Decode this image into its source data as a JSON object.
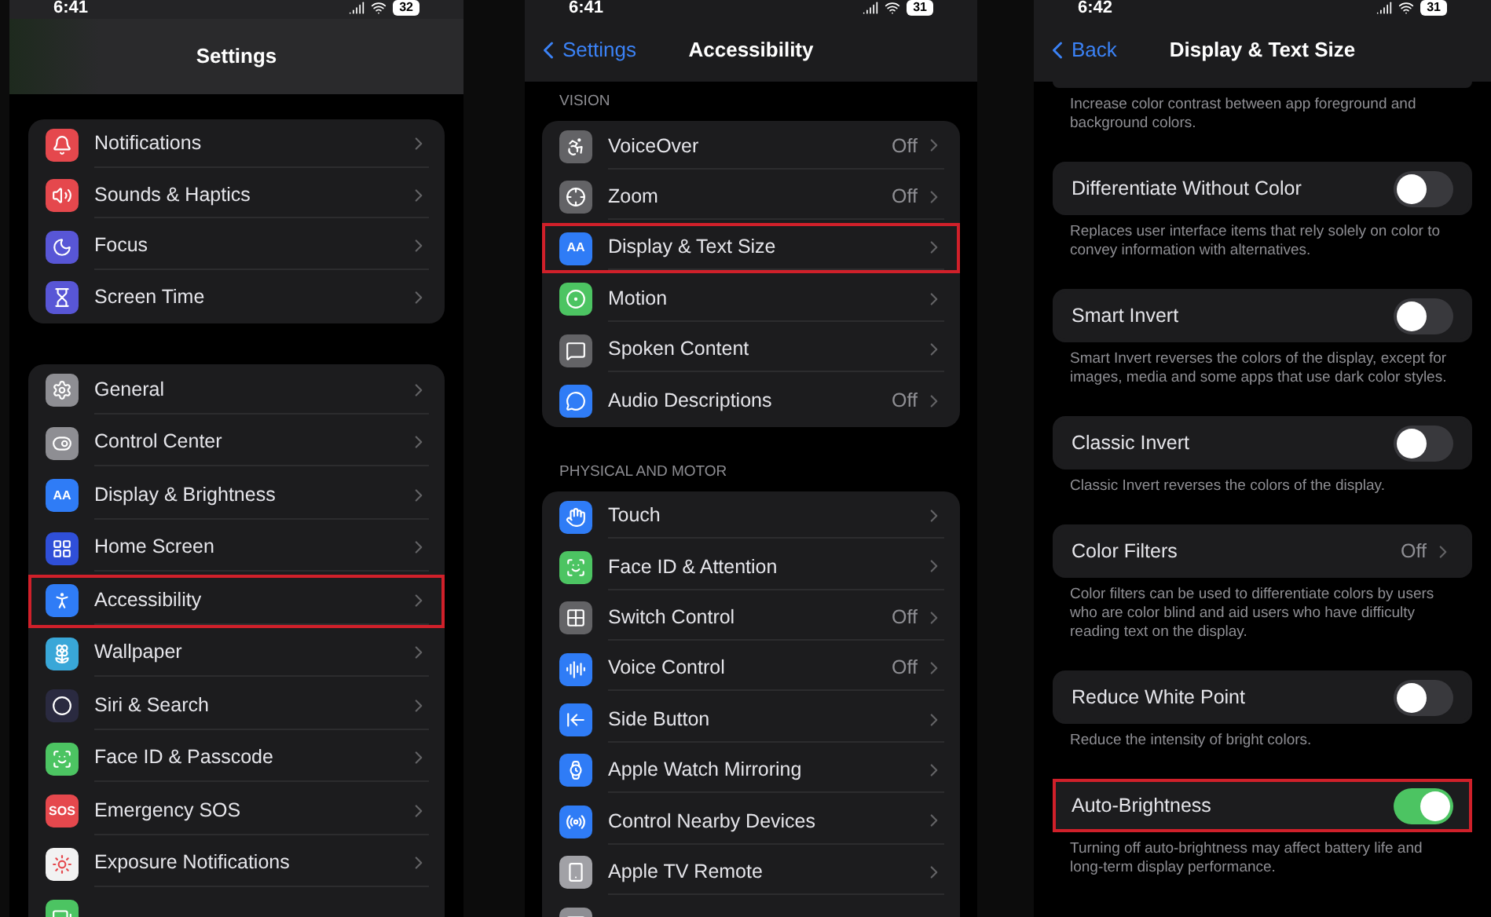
{
  "panels": [
    {
      "status": {
        "time": "6:41",
        "battery": "32"
      },
      "nav": {
        "title": "Settings"
      },
      "sections": [
        {
          "rows": [
            {
              "label": "Notifications",
              "color": "#e5484d",
              "highlighted": false
            },
            {
              "label": "Sounds & Haptics",
              "color": "#e5484d",
              "highlighted": false
            },
            {
              "label": "Focus",
              "color": "#5856d6",
              "highlighted": false
            },
            {
              "label": "Screen Time",
              "color": "#5856d6",
              "highlighted": false
            }
          ]
        },
        {
          "rows": [
            {
              "label": "General",
              "color": "#8e8e93",
              "highlighted": false
            },
            {
              "label": "Control Center",
              "color": "#8e8e93",
              "highlighted": false
            },
            {
              "label": "Display & Brightness",
              "color": "#2f7cf6",
              "badge": "AA",
              "highlighted": false
            },
            {
              "label": "Home Screen",
              "color": "#2f4fd8",
              "highlighted": false
            },
            {
              "label": "Accessibility",
              "color": "#2f7cf6",
              "highlighted": true
            },
            {
              "label": "Wallpaper",
              "color": "#39a7d8",
              "highlighted": false
            },
            {
              "label": "Siri & Search",
              "color": "#2a2a40",
              "highlighted": false
            },
            {
              "label": "Face ID & Passcode",
              "color": "#4cc462",
              "highlighted": false
            },
            {
              "label": "Emergency SOS",
              "color": "#e5484d",
              "badge": "SOS",
              "highlighted": false
            },
            {
              "label": "Exposure Notifications",
              "color": "#f2f2f2",
              "highlighted": false
            },
            {
              "color": "#4cc462",
              "highlighted": false
            }
          ]
        }
      ]
    },
    {
      "status": {
        "time": "6:41",
        "battery": "31"
      },
      "nav": {
        "back": "Settings",
        "title": "Accessibility"
      },
      "sections": [
        {
          "header": "VISION",
          "rows": [
            {
              "label": "VoiceOver",
              "value": "Off",
              "color": "#636366",
              "highlighted": false
            },
            {
              "label": "Zoom",
              "value": "Off",
              "color": "#636366",
              "highlighted": false
            },
            {
              "label": "Display & Text Size",
              "color": "#2f7cf6",
              "badge": "AA",
              "highlighted": true
            },
            {
              "label": "Motion",
              "color": "#4cc462",
              "highlighted": false
            },
            {
              "label": "Spoken Content",
              "color": "#636366",
              "highlighted": false
            },
            {
              "label": "Audio Descriptions",
              "value": "Off",
              "color": "#2f7cf6",
              "highlighted": false
            }
          ]
        },
        {
          "header": "PHYSICAL AND MOTOR",
          "rows": [
            {
              "label": "Touch",
              "color": "#2f7cf6",
              "highlighted": false
            },
            {
              "label": "Face ID & Attention",
              "color": "#4cc462",
              "highlighted": false
            },
            {
              "label": "Switch Control",
              "value": "Off",
              "color": "#636366",
              "highlighted": false
            },
            {
              "label": "Voice Control",
              "value": "Off",
              "color": "#2f7cf6",
              "highlighted": false
            },
            {
              "label": "Side Button",
              "color": "#2f7cf6",
              "highlighted": false
            },
            {
              "label": "Apple Watch Mirroring",
              "color": "#2f7cf6",
              "highlighted": false
            },
            {
              "label": "Control Nearby Devices",
              "color": "#2f7cf6",
              "highlighted": false
            },
            {
              "label": "Apple TV Remote",
              "color": "#a1a1a6",
              "highlighted": false
            },
            {
              "color": "#8e8e93",
              "highlighted": false
            }
          ]
        }
      ]
    }
  ],
  "detail": {
    "status": {
      "time": "6:42",
      "battery": "31"
    },
    "nav": {
      "back": "Back",
      "title": "Display & Text Size"
    },
    "items": [
      {
        "kind": "cut",
        "note": "Increase color contrast between app foreground and background colors."
      },
      {
        "kind": "toggle",
        "label": "Differentiate Without Color",
        "on": false,
        "note": "Replaces user interface items that rely solely on color to convey information with alternatives.",
        "highlighted": false
      },
      {
        "kind": "toggle",
        "label": "Smart Invert",
        "on": false,
        "note": "Smart Invert reverses the colors of the display, except for images, media and some apps that use dark color styles.",
        "highlighted": false
      },
      {
        "kind": "toggle",
        "label": "Classic Invert",
        "on": false,
        "note": "Classic Invert reverses the colors of the display.",
        "highlighted": false
      },
      {
        "kind": "link",
        "label": "Color Filters",
        "value": "Off",
        "note": "Color filters can be used to differentiate colors by users who are color blind and aid users who have difficulty reading text on the display.",
        "highlighted": false
      },
      {
        "kind": "toggle",
        "label": "Reduce White Point",
        "on": false,
        "note": "Reduce the intensity of bright colors.",
        "highlighted": false
      },
      {
        "kind": "toggle",
        "label": "Auto-Brightness",
        "on": true,
        "note": "Turning off auto-brightness may affect battery life and long-term display performance.",
        "highlighted": true
      }
    ]
  }
}
